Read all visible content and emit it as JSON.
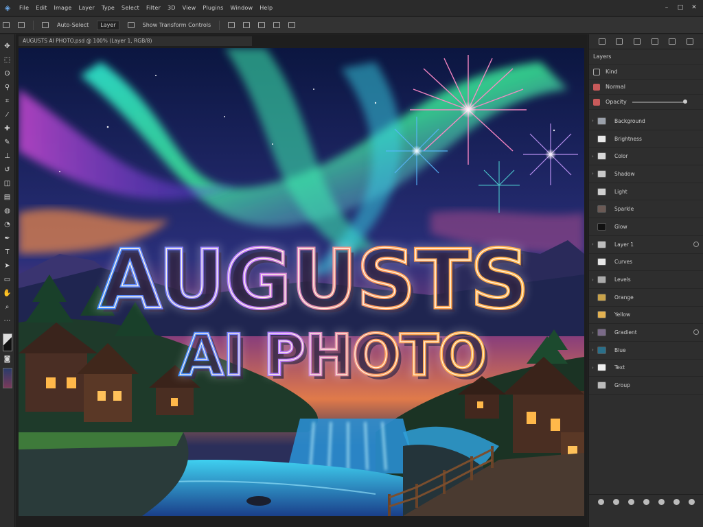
{
  "menubar": {
    "items": [
      "File",
      "Edit",
      "Image",
      "Layer",
      "Type",
      "Select",
      "Filter",
      "3D",
      "View",
      "Plugins",
      "Window",
      "Help"
    ]
  },
  "optionsbar": {
    "fields": [
      "Auto-Select",
      "Layer",
      "Show Transform Controls"
    ]
  },
  "document": {
    "tab_title": "AUGUSTS AI PHOTO.psd @ 100% (Layer 1, RGB/8)"
  },
  "artwork": {
    "line1": "AUGUSTS",
    "line2": "AI PHOTO"
  },
  "rpanel": {
    "row1": "Layers",
    "row2": "Kind",
    "row3": "Normal",
    "row4": "Opacity"
  },
  "layers": [
    {
      "name": "Background",
      "color": "#9aa0aa",
      "caret": true,
      "fx": false
    },
    {
      "name": "Brightness",
      "color": "#e8e8e8",
      "caret": false,
      "fx": false
    },
    {
      "name": "Color",
      "color": "#d8d8d8",
      "caret": true,
      "fx": false
    },
    {
      "name": "Shadow",
      "color": "#c8c8c8",
      "caret": true,
      "fx": false
    },
    {
      "name": "Light",
      "color": "#cfcfcf",
      "caret": false,
      "fx": false
    },
    {
      "name": "Sparkle",
      "color": "#6b5a55",
      "caret": false,
      "fx": false
    },
    {
      "name": "Glow",
      "color": "#111111",
      "caret": false,
      "fx": false
    },
    {
      "name": "Layer 1",
      "color": "#bdbdbd",
      "caret": true,
      "fx": true
    },
    {
      "name": "Curves",
      "color": "#e6e6e6",
      "caret": false,
      "fx": false
    },
    {
      "name": "Levels",
      "color": "#aaaaaa",
      "caret": true,
      "fx": false
    },
    {
      "name": "Orange",
      "color": "#c9a34a",
      "caret": false,
      "fx": false
    },
    {
      "name": "Yellow",
      "color": "#e3b251",
      "caret": false,
      "fx": false
    },
    {
      "name": "Gradient",
      "color": "#7a6a88",
      "caret": true,
      "fx": true
    },
    {
      "name": "Blue",
      "color": "#2a6f8a",
      "caret": true,
      "fx": false
    },
    {
      "name": "Text",
      "color": "#eeeeee",
      "caret": true,
      "fx": false
    },
    {
      "name": "Group",
      "color": "#bbbbbb",
      "caret": false,
      "fx": false
    }
  ]
}
